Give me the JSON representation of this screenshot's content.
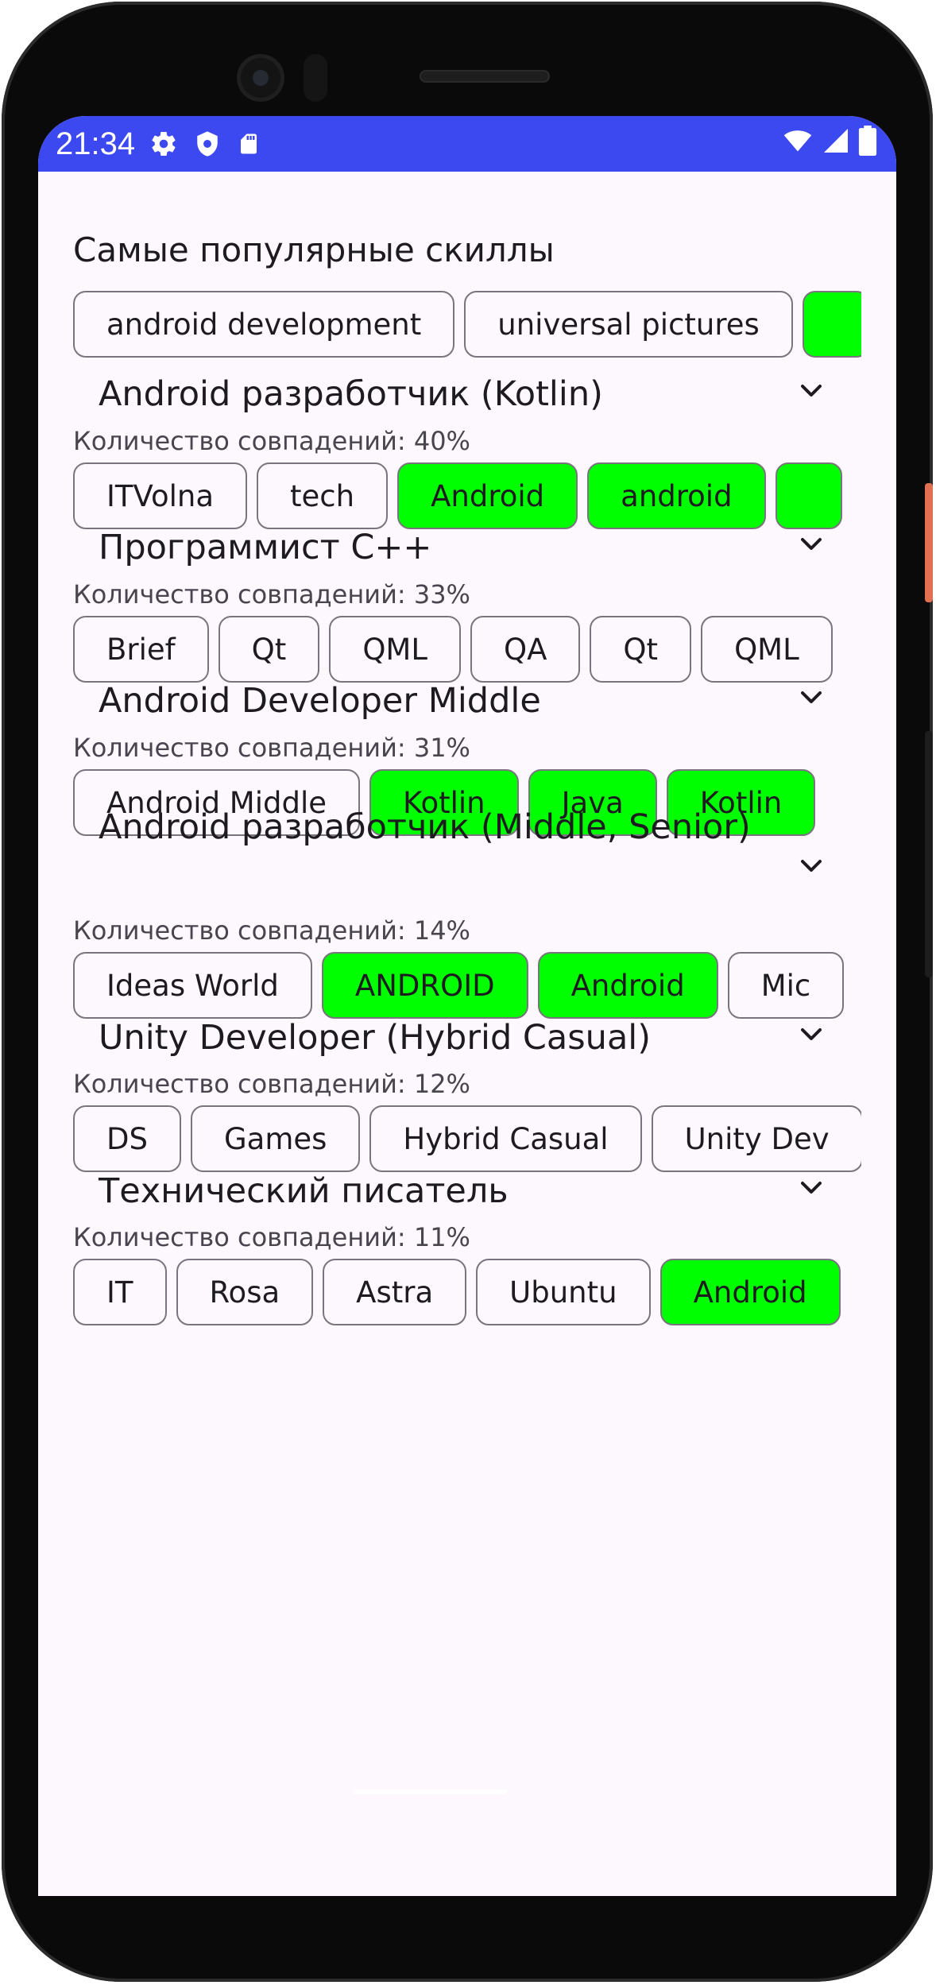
{
  "status_bar": {
    "time": "21:34",
    "left_icons": [
      "gear-icon",
      "shield-icon",
      "sd-card-icon"
    ],
    "right_icons": [
      "wifi-icon",
      "signal-icon",
      "battery-icon"
    ],
    "color": "#3c49f0"
  },
  "popular": {
    "title": "Самые популярные скиллы",
    "chips": [
      {
        "label": "android development",
        "highlighted": false
      },
      {
        "label": "universal pictures",
        "highlighted": false
      },
      {
        "label": "",
        "highlighted": true
      }
    ]
  },
  "vacancies": [
    {
      "title": "Android разработчик (Kotlin)",
      "match": "Количество совпадений: 40%",
      "skills": [
        {
          "label": "ITVolna",
          "highlighted": false
        },
        {
          "label": "tech",
          "highlighted": false
        },
        {
          "label": "Android",
          "highlighted": true
        },
        {
          "label": "android",
          "highlighted": true
        },
        {
          "label": "",
          "highlighted": true
        }
      ]
    },
    {
      "title": "Программист C++",
      "match": "Количество совпадений: 33%",
      "skills": [
        {
          "label": "Brief",
          "highlighted": false
        },
        {
          "label": "Qt",
          "highlighted": false
        },
        {
          "label": "QML",
          "highlighted": false
        },
        {
          "label": "QA",
          "highlighted": false
        },
        {
          "label": "Qt",
          "highlighted": false
        },
        {
          "label": "QML",
          "highlighted": false
        }
      ]
    },
    {
      "title": "Android Developer Middle",
      "match": "Количество совпадений: 31%",
      "skills": [
        {
          "label": "Android Middle",
          "highlighted": false
        },
        {
          "label": "Kotlin",
          "highlighted": true
        },
        {
          "label": "Java",
          "highlighted": true
        },
        {
          "label": "Kotlin",
          "highlighted": true
        }
      ]
    },
    {
      "title": "Android разработчик (Middle, Senior)",
      "match": "Количество совпадений: 14%",
      "skills": [
        {
          "label": "Ideas World",
          "highlighted": false
        },
        {
          "label": "ANDROID",
          "highlighted": true
        },
        {
          "label": "Android",
          "highlighted": true
        },
        {
          "label": "Mic",
          "highlighted": false
        }
      ]
    },
    {
      "title": "Unity Developer (Hybrid Casual)",
      "match": "Количество совпадений: 12%",
      "skills": [
        {
          "label": "DS",
          "highlighted": false
        },
        {
          "label": "Games",
          "highlighted": false
        },
        {
          "label": "Hybrid Casual",
          "highlighted": false
        },
        {
          "label": "Unity Dev",
          "highlighted": false
        }
      ]
    },
    {
      "title": "Технический писатель",
      "match": "Количество совпадений: 11%",
      "skills": [
        {
          "label": "IT",
          "highlighted": false
        },
        {
          "label": "Rosa",
          "highlighted": false
        },
        {
          "label": "Astra",
          "highlighted": false
        },
        {
          "label": "Ubuntu",
          "highlighted": false
        },
        {
          "label": "Android",
          "highlighted": true
        }
      ]
    }
  ],
  "colors": {
    "highlight": "#00ff00",
    "background": "#fdf8fd",
    "chip_border": "#79747e"
  }
}
